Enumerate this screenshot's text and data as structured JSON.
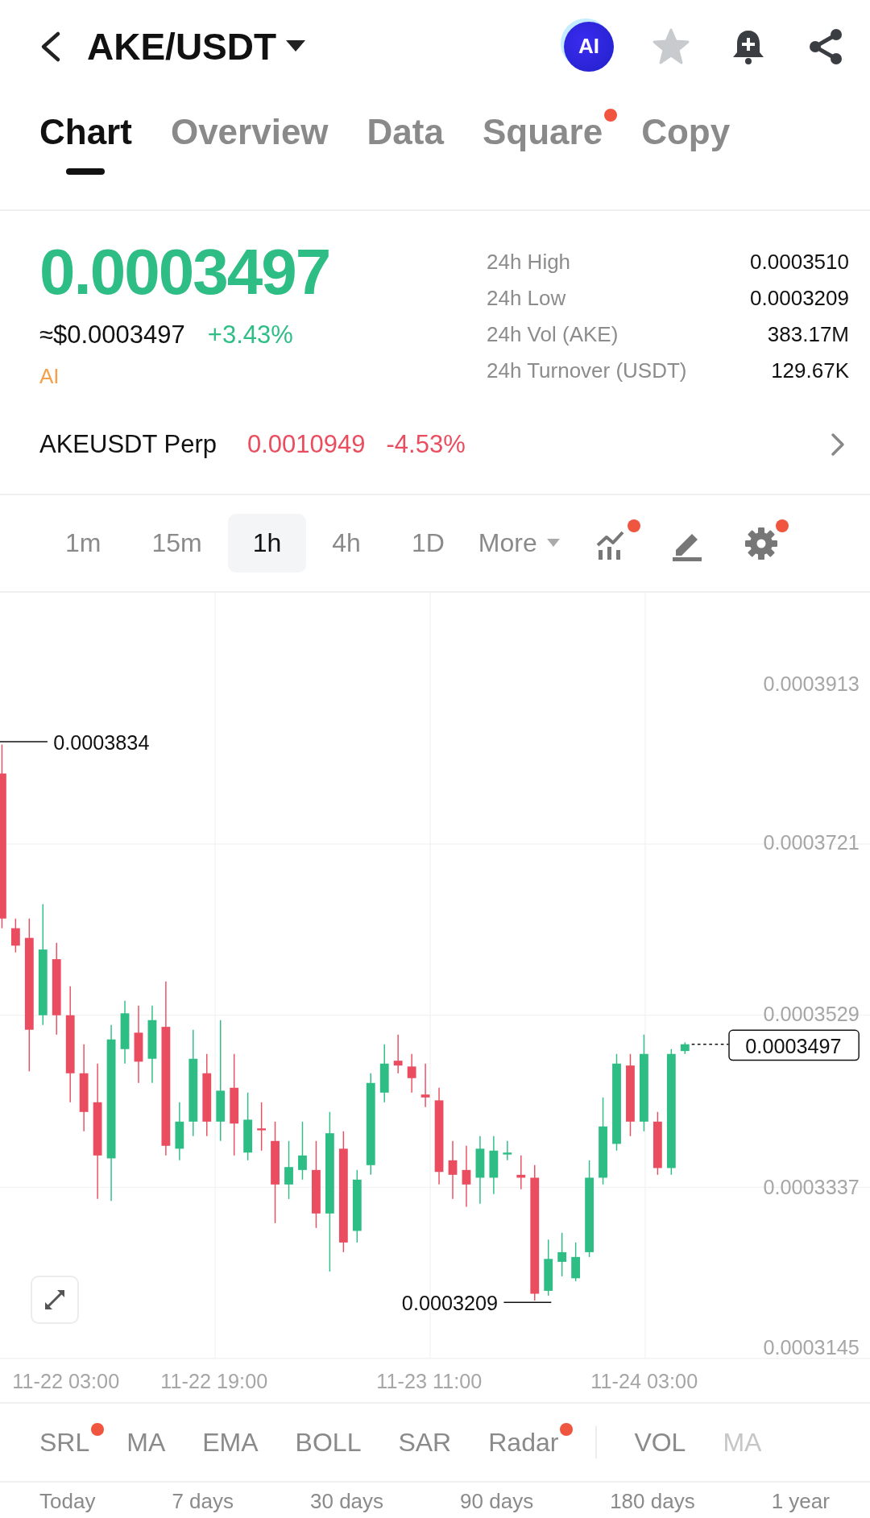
{
  "header": {
    "title": "AKE/USDT",
    "ai_badge": "AI"
  },
  "tabs": [
    {
      "label": "Chart",
      "selected": true,
      "dot": false
    },
    {
      "label": "Overview",
      "selected": false,
      "dot": false
    },
    {
      "label": "Data",
      "selected": false,
      "dot": false
    },
    {
      "label": "Square",
      "selected": false,
      "dot": true
    },
    {
      "label": "Copy",
      "selected": false,
      "dot": false
    }
  ],
  "ticker": {
    "price": "0.0003497",
    "usd_price": "≈$0.0003497",
    "change": "+3.43%",
    "ai_label": "AI",
    "stats": [
      {
        "label": "24h High",
        "value": "0.0003510"
      },
      {
        "label": "24h Low",
        "value": "0.0003209"
      },
      {
        "label": "24h Vol (AKE)",
        "value": "383.17M"
      },
      {
        "label": "24h Turnover (USDT)",
        "value": "129.67K"
      }
    ]
  },
  "perp": {
    "name": "AKEUSDT Perp",
    "price": "0.0010949",
    "change": "-4.53%"
  },
  "timeframes": [
    {
      "label": "1m",
      "selected": false
    },
    {
      "label": "15m",
      "selected": false
    },
    {
      "label": "1h",
      "selected": true
    },
    {
      "label": "4h",
      "selected": false
    },
    {
      "label": "1D",
      "selected": false
    }
  ],
  "more": "More",
  "tools": [
    {
      "kind": "indicators",
      "dot": true
    },
    {
      "kind": "draw",
      "dot": false
    },
    {
      "kind": "settings",
      "dot": true
    }
  ],
  "chart": {
    "price_labels": [
      "0.0003913",
      "0.0003721",
      "0.0003529",
      "0.0003337",
      "0.0003145"
    ],
    "time_labels": [
      "11-22 03:00",
      "11-22 19:00",
      "11-23 11:00",
      "11-24 03:00"
    ],
    "high_marker": "0.0003834",
    "low_marker": "0.0003209",
    "current_price": "0.0003497"
  },
  "indicators": [
    {
      "label": "SRL",
      "dot": true
    },
    {
      "label": "MA",
      "dot": false
    },
    {
      "label": "EMA",
      "dot": false
    },
    {
      "label": "BOLL",
      "dot": false
    },
    {
      "label": "SAR",
      "dot": false
    },
    {
      "label": "Radar",
      "dot": true
    },
    {
      "label": "VOL",
      "dot": false
    },
    {
      "label": "MA",
      "dot": false
    }
  ],
  "ranges": [
    "Today",
    "7 days",
    "30 days",
    "90 days",
    "180 days",
    "1 year"
  ]
}
